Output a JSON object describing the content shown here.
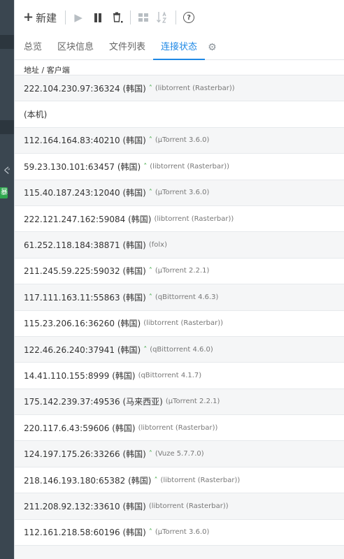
{
  "sidebar": {
    "char": "ぐ",
    "badge": "暴"
  },
  "toolbar": {
    "new_label": "新建",
    "new_icon": "plus-icon",
    "icons": [
      "play-icon",
      "pause-icon",
      "trash-icon",
      "grid-icon",
      "sort-az-icon",
      "help-icon"
    ]
  },
  "tabs": [
    {
      "label": "总览",
      "active": false
    },
    {
      "label": "区块信息",
      "active": false
    },
    {
      "label": "文件列表",
      "active": false
    },
    {
      "label": "连接状态",
      "active": true
    }
  ],
  "column_header": "地址 / 客户端",
  "peers": [
    {
      "address": "222.104.230.97:36324 (韩国)",
      "chevron": true,
      "client": "(libtorrent (Rasterbar))"
    },
    {
      "address": "(本机)",
      "chevron": false,
      "client": ""
    },
    {
      "address": "112.164.164.83:40210 (韩国)",
      "chevron": true,
      "client": "(µTorrent 3.6.0)"
    },
    {
      "address": "59.23.130.101:63457 (韩国)",
      "chevron": true,
      "client": "(libtorrent (Rasterbar))"
    },
    {
      "address": "115.40.187.243:12040 (韩国)",
      "chevron": true,
      "client": "(µTorrent 3.6.0)"
    },
    {
      "address": "222.121.247.162:59084 (韩国)",
      "chevron": false,
      "client": "(libtorrent (Rasterbar))"
    },
    {
      "address": "61.252.118.184:38871 (韩国)",
      "chevron": false,
      "client": "(folx)"
    },
    {
      "address": "211.245.59.225:59032 (韩国)",
      "chevron": true,
      "client": "(µTorrent 2.2.1)"
    },
    {
      "address": "117.111.163.11:55863 (韩国)",
      "chevron": true,
      "client": "(qBittorrent 4.6.3)"
    },
    {
      "address": "115.23.206.16:36260 (韩国)",
      "chevron": false,
      "client": "(libtorrent (Rasterbar))"
    },
    {
      "address": "122.46.26.240:37941 (韩国)",
      "chevron": true,
      "client": "(qBittorrent 4.6.0)"
    },
    {
      "address": "14.41.110.155:8999 (韩国)",
      "chevron": false,
      "client": "(qBittorrent 4.1.7)"
    },
    {
      "address": "175.142.239.37:49536 (马来西亚)",
      "chevron": false,
      "client": "(µTorrent 2.2.1)"
    },
    {
      "address": "220.117.6.43:59606 (韩国)",
      "chevron": false,
      "client": "(libtorrent (Rasterbar))"
    },
    {
      "address": "124.197.175.26:33266 (韩国)",
      "chevron": true,
      "client": "(Vuze 5.7.7.0)"
    },
    {
      "address": "218.146.193.180:65382 (韩国)",
      "chevron": true,
      "client": "(libtorrent (Rasterbar))"
    },
    {
      "address": "211.208.92.132:33610 (韩国)",
      "chevron": false,
      "client": "(libtorrent (Rasterbar))"
    },
    {
      "address": "112.161.218.58:60196 (韩国)",
      "chevron": true,
      "client": "(µTorrent 3.6.0)"
    },
    {
      "address": "",
      "chevron": false,
      "client": ""
    }
  ],
  "colors": {
    "accent": "#1e88e5",
    "sidebar": "#3a4650",
    "chevron": "#4caf50",
    "badge": "#2fa84f"
  }
}
